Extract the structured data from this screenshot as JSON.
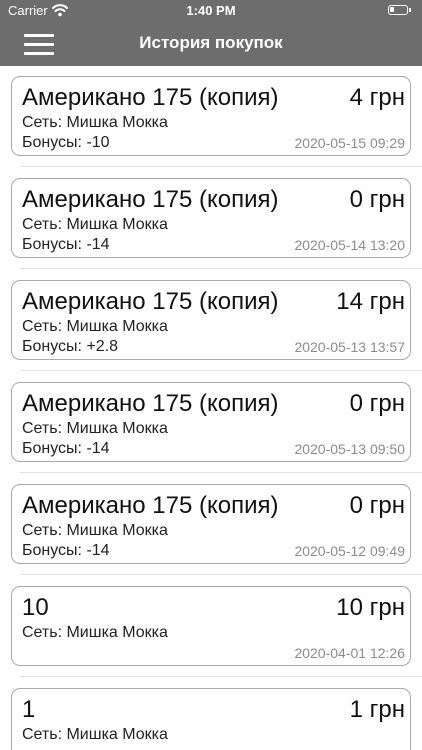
{
  "status_bar": {
    "carrier": "Carrier",
    "time": "1:40 PM",
    "wifi_icon": "wifi-icon",
    "battery_icon": "battery-icon"
  },
  "nav": {
    "title": "История покупок",
    "menu_icon": "hamburger-menu-icon",
    "bar_color": "#6d6d6d"
  },
  "purchases": [
    {
      "name": "Американо 175 (копия)",
      "price": "4 грн",
      "network": "Сеть: Мишка Мокка",
      "bonus": "Бонусы: -10",
      "date": "2020-05-15 09:29"
    },
    {
      "name": "Американо 175 (копия)",
      "price": "0 грн",
      "network": "Сеть: Мишка Мокка",
      "bonus": "Бонусы: -14",
      "date": "2020-05-14 13:20"
    },
    {
      "name": "Американо 175 (копия)",
      "price": "14 грн",
      "network": "Сеть: Мишка Мокка",
      "bonus": "Бонусы: +2.8",
      "date": "2020-05-13 13:57"
    },
    {
      "name": "Американо 175 (копия)",
      "price": "0 грн",
      "network": "Сеть: Мишка Мокка",
      "bonus": "Бонусы: -14",
      "date": "2020-05-13 09:50"
    },
    {
      "name": "Американо 175 (копия)",
      "price": "0 грн",
      "network": "Сеть: Мишка Мокка",
      "bonus": "Бонусы: -14",
      "date": "2020-05-12 09:49"
    },
    {
      "name": "10",
      "price": "10 грн",
      "network": "Сеть: Мишка Мокка",
      "bonus": "",
      "date": "2020-04-01 12:26"
    },
    {
      "name": "1",
      "price": "1 грн",
      "network": "Сеть: Мишка Мокка",
      "bonus": "",
      "date": ""
    }
  ]
}
